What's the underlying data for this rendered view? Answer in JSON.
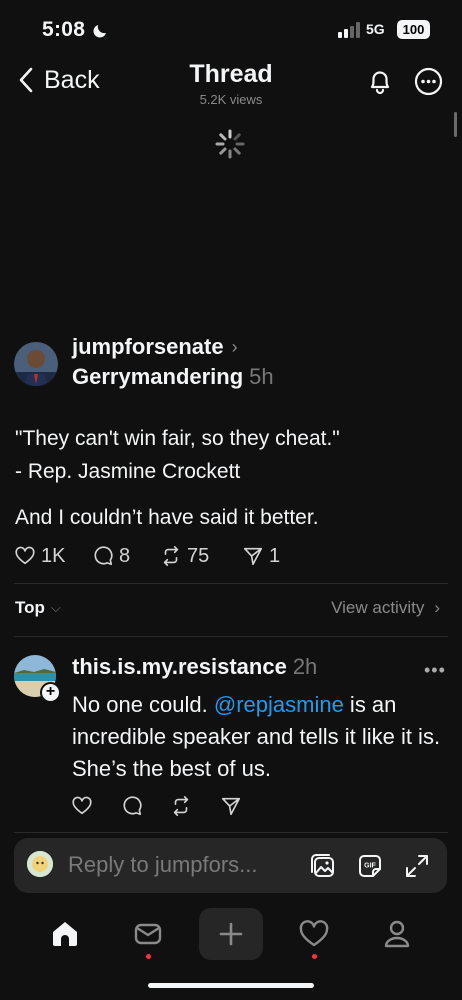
{
  "status_bar": {
    "time": "5:08",
    "network": "5G",
    "battery": "100"
  },
  "nav": {
    "back_label": "Back",
    "title": "Thread",
    "subtitle": "5.2K views"
  },
  "post": {
    "username": "jumpforsenate",
    "topic": "Gerrymandering",
    "time": "5h",
    "lines": [
      "\"They can't win fair, so they cheat.\"",
      "- Rep. Jasmine Crockett",
      "And I couldn’t have said it better."
    ],
    "likes": "1K",
    "replies": "8",
    "reposts": "75",
    "shares": "1"
  },
  "sort": {
    "label": "Top",
    "view_activity": "View activity"
  },
  "reply": {
    "username": "this.is.my.resistance",
    "time": "2h",
    "text_before": "No one could. ",
    "mention": "@repjasmine",
    "text_after": " is an incredible speaker and tells it like it is. She’s the best of us."
  },
  "reply_bar": {
    "placeholder": "Reply to jumpfors..."
  },
  "colors": {
    "background": "#101010",
    "mention": "#1d9bf0",
    "notification_dot": "#ff3040"
  },
  "icons": [
    "chevron-left-icon",
    "bell-icon",
    "more-icon",
    "heart-icon",
    "comment-icon",
    "repost-icon",
    "share-icon",
    "gallery-icon",
    "gif-icon",
    "expand-icon",
    "home-icon",
    "inbox-icon",
    "plus-icon",
    "activity-heart-icon",
    "profile-icon"
  ]
}
